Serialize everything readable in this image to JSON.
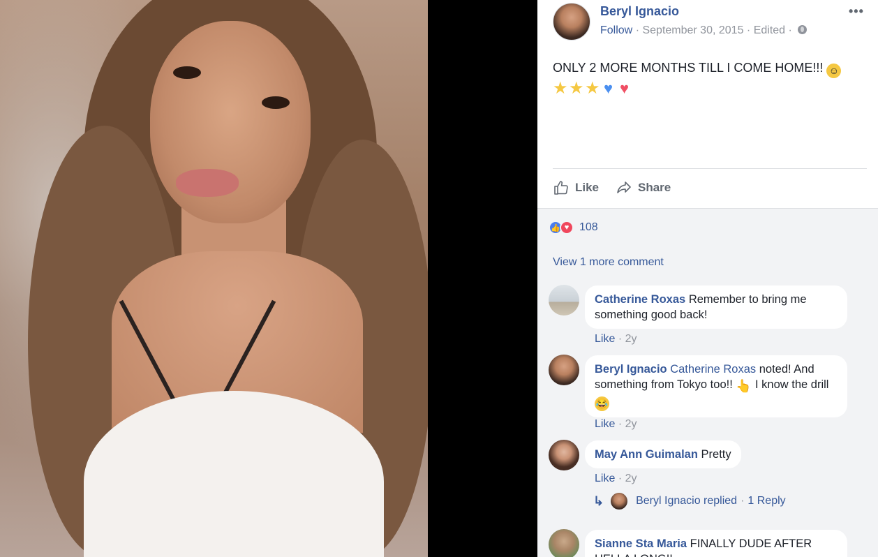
{
  "post": {
    "author": "Beryl Ignacio",
    "follow": "Follow",
    "date": "September 30, 2015",
    "edited": "Edited",
    "more_label": "•••",
    "text": "ONLY 2 MORE MONTHS TILL I COME HOME!!!",
    "emojis": [
      "smiling-face",
      "star",
      "star",
      "star",
      "blue-heart",
      "red-heart"
    ],
    "actions": {
      "like": "Like",
      "share": "Share"
    }
  },
  "reactions": {
    "count": "108",
    "types": [
      "like",
      "love"
    ],
    "like_color": "#4a7dee",
    "love_color": "#f0475c"
  },
  "view_more": "View 1 more comment",
  "comments": [
    {
      "author": "Catherine Roxas",
      "text": "Remember to bring me something good back!",
      "like": "Like",
      "age": "2y"
    },
    {
      "author": "Beryl Ignacio",
      "mention": "Catherine Roxas",
      "text_a": "noted! And something from Tokyo too!!",
      "text_b": "I know the drill",
      "like": "Like",
      "age": "2y"
    },
    {
      "author": "May Ann Guimalan",
      "text": "Pretty",
      "like": "Like",
      "age": "2y",
      "reply_summary": {
        "who": "Beryl Ignacio replied",
        "count": "1 Reply"
      }
    },
    {
      "author": "Sianne Sta Maria",
      "text": "FINALLY DUDE AFTER HELLA LONG!!"
    }
  ],
  "colors": {
    "link": "#365899",
    "meta": "#90949c",
    "comment_bg": "#f2f3f5"
  }
}
